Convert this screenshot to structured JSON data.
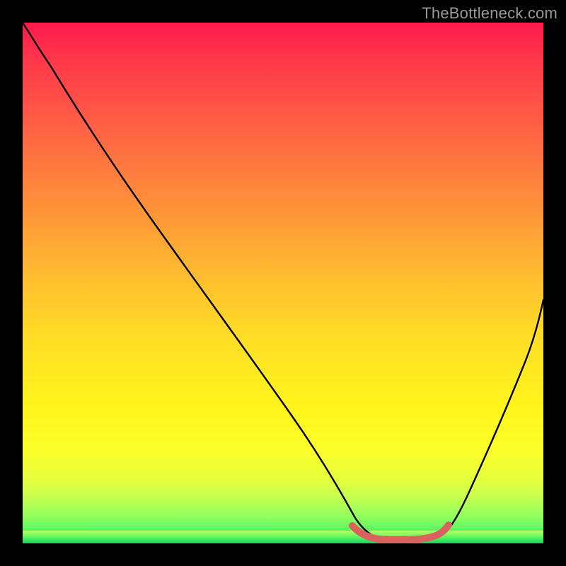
{
  "watermark": "TheBottleneck.com",
  "chart_data": {
    "type": "line",
    "title": "",
    "xlabel": "",
    "ylabel": "",
    "xlim": [
      0,
      100
    ],
    "ylim": [
      0,
      100
    ],
    "grid": false,
    "legend": false,
    "series": [
      {
        "name": "bottleneck-curve",
        "x": [
          0,
          3,
          8,
          15,
          25,
          35,
          45,
          55,
          61,
          64,
          68,
          73,
          77,
          80,
          83,
          87,
          92,
          100
        ],
        "y": [
          100,
          97,
          92,
          83,
          70,
          56,
          43,
          29,
          18,
          10,
          4,
          1,
          1,
          1,
          4,
          12,
          25,
          47
        ]
      },
      {
        "name": "trough-highlight",
        "x": [
          63,
          66,
          70,
          74,
          78,
          81
        ],
        "y": [
          2.2,
          1.3,
          0.9,
          0.9,
          1.3,
          2.2
        ]
      }
    ],
    "colors": {
      "curve": "#000000",
      "highlight": "#d9625f",
      "gradient_top": "#ff1a4d",
      "gradient_bottom": "#18d060"
    }
  }
}
